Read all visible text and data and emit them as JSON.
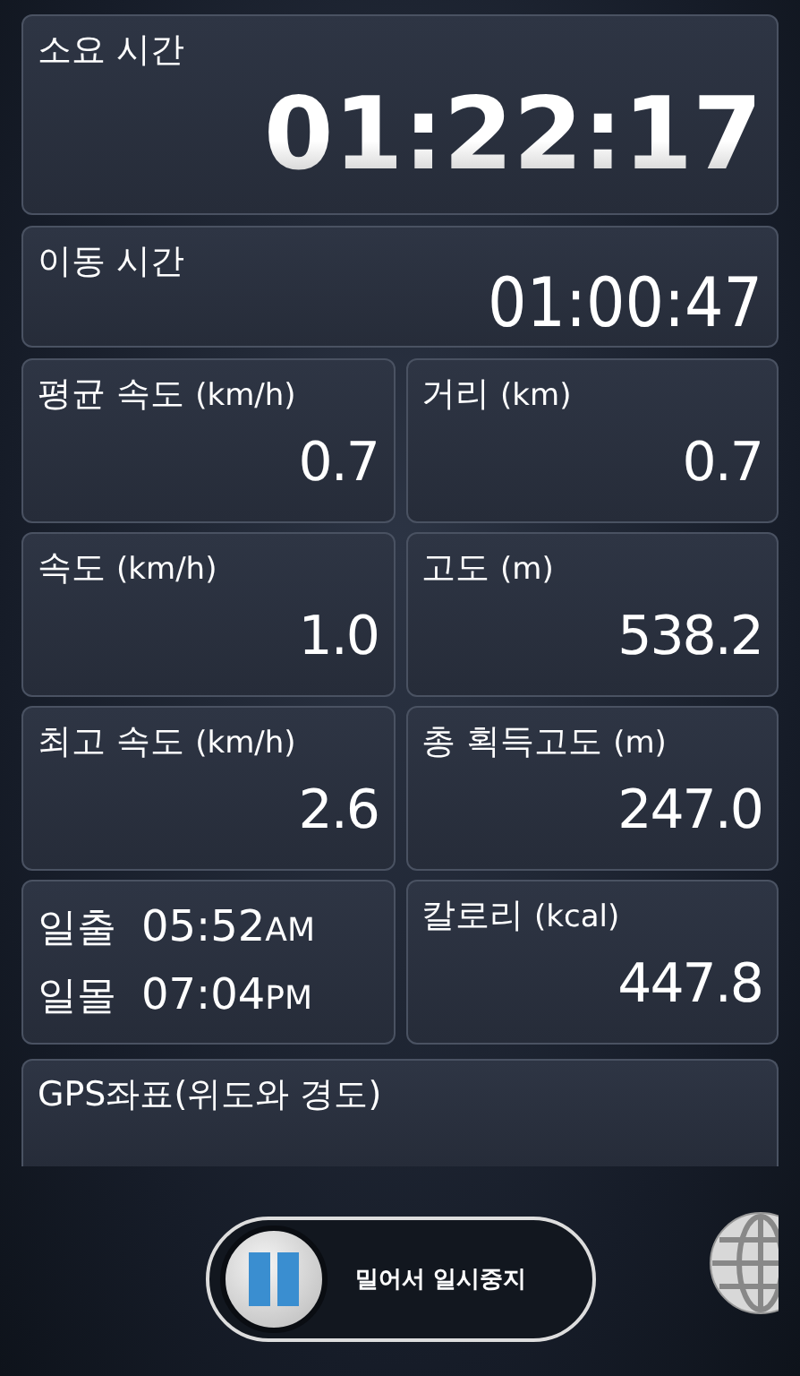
{
  "total_time": {
    "label": "소요 시간",
    "value": "01:22:17"
  },
  "moving_time": {
    "label": "이동 시간",
    "value": "01:00:47"
  },
  "cells": [
    {
      "kind": "stat",
      "label": "평균 속도",
      "unit": "(km/h)",
      "value": "0.7"
    },
    {
      "kind": "stat",
      "label": "거리",
      "unit": "(km)",
      "value": "0.7"
    },
    {
      "kind": "stat",
      "label": "속도",
      "unit": "(km/h)",
      "value": "1.0"
    },
    {
      "kind": "stat",
      "label": "고도",
      "unit": "(m)",
      "value": "538.2"
    },
    {
      "kind": "stat",
      "label": "최고 속도",
      "unit": "(km/h)",
      "value": "2.6"
    },
    {
      "kind": "stat",
      "label": "총 획득고도",
      "unit": "(m)",
      "value": "247.0"
    },
    {
      "kind": "sun",
      "rows": [
        {
          "label": "일출",
          "time": "05:52",
          "ampm": "AM"
        },
        {
          "label": "일몰",
          "time": "07:04",
          "ampm": "PM"
        }
      ]
    },
    {
      "kind": "stat",
      "label": "칼로리",
      "unit": "(kcal)",
      "value": "447.8"
    }
  ],
  "gps": {
    "label": "GPS좌표(위도와 경도)"
  },
  "slider": {
    "label": "밀어서 일시중지",
    "level": 0
  }
}
